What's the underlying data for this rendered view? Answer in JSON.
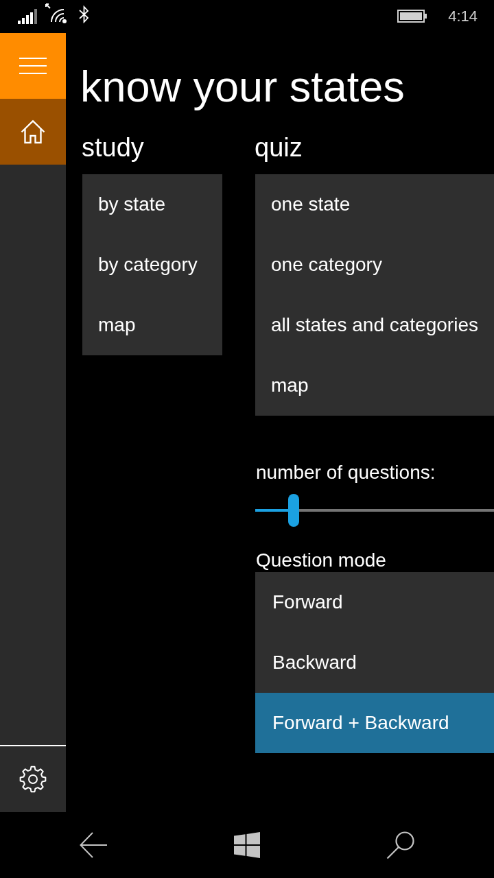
{
  "status_bar": {
    "time": "4:14"
  },
  "nav_pane": {
    "top_items": [
      {
        "kind": "home",
        "selected": true
      }
    ],
    "bottom_items": [
      {
        "kind": "settings",
        "selected": false
      }
    ]
  },
  "title": "know your states",
  "study": {
    "heading": "study",
    "items": [
      {
        "label": "by state"
      },
      {
        "label": "by category"
      },
      {
        "label": "map"
      }
    ]
  },
  "quiz": {
    "heading": "quiz",
    "items": [
      {
        "label": "one state"
      },
      {
        "label": "one category"
      },
      {
        "label": "all states and categories"
      },
      {
        "label": "map"
      }
    ],
    "questions": {
      "label": "number of questions:",
      "level": 0.16
    },
    "question_mode": {
      "label": "Question mode",
      "options": [
        {
          "label": "Forward",
          "selected": false
        },
        {
          "label": "Backward",
          "selected": false
        },
        {
          "label": "Forward + Backward",
          "selected": true
        }
      ]
    }
  }
}
